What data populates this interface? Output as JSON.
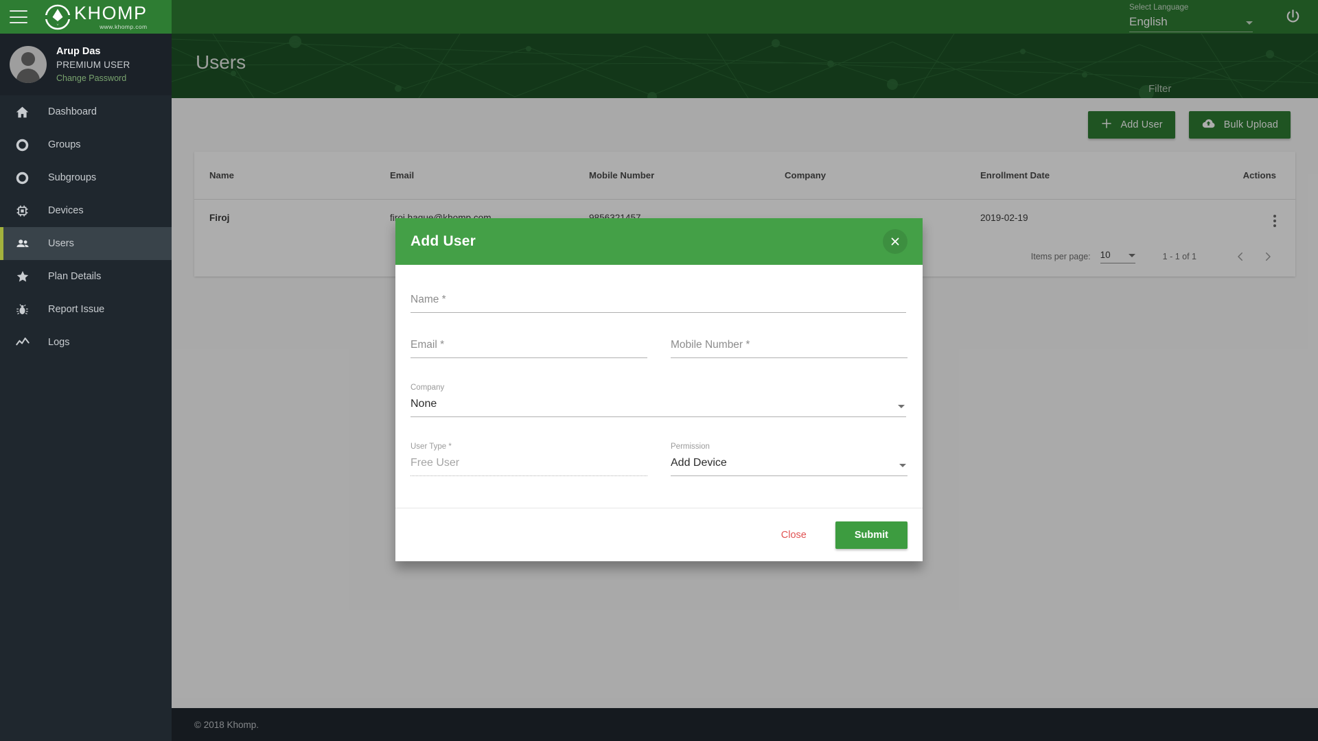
{
  "topbar": {
    "menu_icon": "hamburger-icon",
    "logo_name": "KHOMP",
    "logo_sub": "www.khomp.com",
    "language_label": "Select Language",
    "language_value": "English",
    "power_icon": "power-icon"
  },
  "sidebar": {
    "profile": {
      "name": "Arup Das",
      "role": "PREMIUM USER",
      "change_password": "Change Password"
    },
    "items": [
      {
        "label": "Dashboard",
        "icon": "home-icon",
        "active": false
      },
      {
        "label": "Groups",
        "icon": "circle-icon",
        "active": false
      },
      {
        "label": "Subgroups",
        "icon": "circle-icon",
        "active": false
      },
      {
        "label": "Devices",
        "icon": "chip-icon",
        "active": false
      },
      {
        "label": "Users",
        "icon": "people-icon",
        "active": true
      },
      {
        "label": "Plan Details",
        "icon": "star-icon",
        "active": false
      },
      {
        "label": "Report Issue",
        "icon": "bug-icon",
        "active": false
      },
      {
        "label": "Logs",
        "icon": "trend-icon",
        "active": false
      }
    ]
  },
  "page": {
    "title": "Users",
    "filter_placeholder": "Filter",
    "add_user_label": "Add User",
    "bulk_upload_label": "Bulk Upload",
    "add_icon": "plus-icon",
    "bulk_icon": "cloud-upload-icon"
  },
  "table": {
    "columns": [
      "Name",
      "Email",
      "Mobile Number",
      "Company",
      "Enrollment Date",
      "Actions"
    ],
    "rows": [
      {
        "name": "Firoj",
        "email": "firoj.haque@khomp.com",
        "mobile": "9856321457",
        "company": "",
        "enrollment_date": "2019-02-19",
        "actions_icon": "kebab-menu-icon"
      }
    ]
  },
  "paginator": {
    "items_per_page_label": "Items per page:",
    "items_per_page_value": "10",
    "range": "1 - 1 of 1",
    "prev_icon": "chevron-left-icon",
    "next_icon": "chevron-right-icon"
  },
  "footer": {
    "copyright": "© 2018 Khomp."
  },
  "dialog": {
    "title": "Add User",
    "close_icon": "close-icon",
    "fields": {
      "name": {
        "label": "",
        "placeholder": "Name *",
        "value": ""
      },
      "email": {
        "label": "",
        "placeholder": "Email *",
        "value": ""
      },
      "mobile": {
        "label": "",
        "placeholder": "Mobile Number *",
        "value": ""
      },
      "company": {
        "label": "Company",
        "value": "None"
      },
      "user_type": {
        "label": "User Type *",
        "value": "Free User"
      },
      "permission": {
        "label": "Permission",
        "value": "Add Device"
      }
    },
    "close_label": "Close",
    "submit_label": "Submit"
  },
  "colors": {
    "brand_green": "#2e7d33",
    "header_green": "#1c5225",
    "dialog_green": "#44a047",
    "submit_green": "#3d9c40",
    "sidebar_dark": "#1f272e",
    "active_accent": "#a4b23d",
    "close_red": "#e05252"
  }
}
